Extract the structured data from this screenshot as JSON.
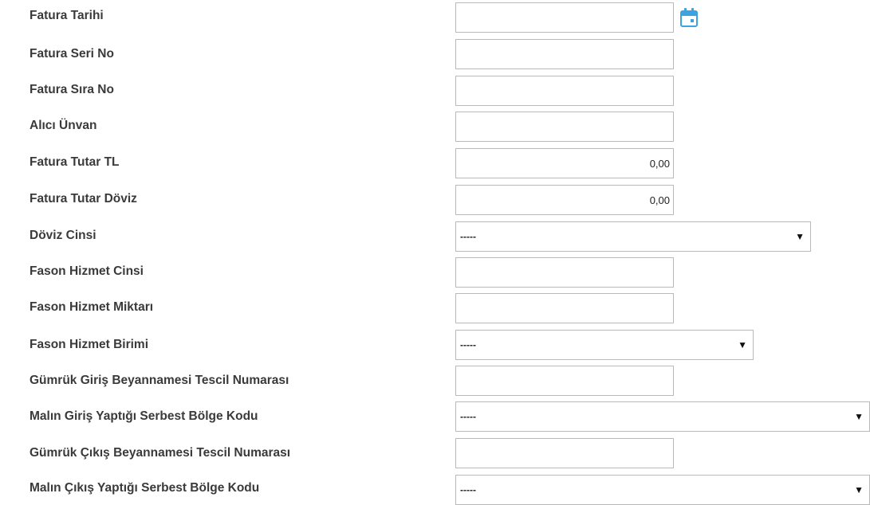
{
  "form": {
    "fatura_tarihi": {
      "label": "Fatura Tarihi",
      "value": ""
    },
    "fatura_seri_no": {
      "label": "Fatura Seri No",
      "value": ""
    },
    "fatura_sira_no": {
      "label": "Fatura Sıra No",
      "value": ""
    },
    "alici_unvan": {
      "label": "Alıcı Ünvan",
      "value": ""
    },
    "fatura_tutar_tl": {
      "label": "Fatura Tutar TL",
      "value": "0,00"
    },
    "fatura_tutar_doviz": {
      "label": "Fatura Tutar Döviz",
      "value": "0,00"
    },
    "doviz_cinsi": {
      "label": "Döviz Cinsi",
      "selected": "-----"
    },
    "fason_hizmet_cinsi": {
      "label": "Fason Hizmet Cinsi",
      "value": ""
    },
    "fason_hizmet_miktari": {
      "label": "Fason Hizmet Miktarı",
      "value": ""
    },
    "fason_hizmet_birimi": {
      "label": "Fason Hizmet Birimi",
      "selected": "-----"
    },
    "gumruk_giris_tescil": {
      "label": "Gümrük Giriş Beyannamesi Tescil Numarası",
      "value": ""
    },
    "malin_giris_bolge": {
      "label": "Malın Giriş Yaptığı Serbest Bölge Kodu",
      "selected": "-----"
    },
    "gumruk_cikis_tescil": {
      "label": "Gümrük Çıkış Beyannamesi Tescil Numarası",
      "value": ""
    },
    "malin_cikis_bolge": {
      "label": "Malın Çıkış Yaptığı Serbest Bölge Kodu",
      "selected": "-----"
    }
  },
  "icons": {
    "calendar": "calendar-icon",
    "dropdown": "triangle-down"
  },
  "colors": {
    "calendar_accent": "#3ba3e0",
    "label_text": "#3a3a3a",
    "border": "#b9b9b9"
  }
}
